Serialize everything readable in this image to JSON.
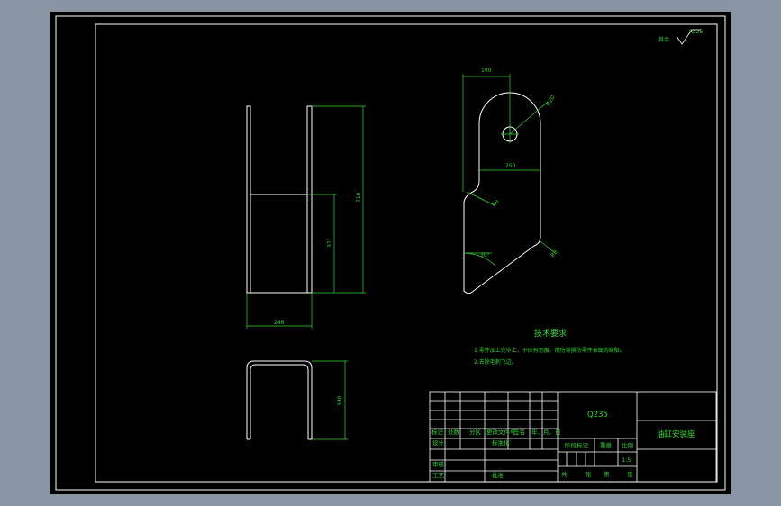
{
  "roughness": {
    "label": "其余",
    "value": "Ra25"
  },
  "dimensions": {
    "top_width": "100",
    "hole": "Φ20",
    "mid_width": "250",
    "fillet_left": "R8",
    "fillet_right": "R8",
    "angle": "30°",
    "side_height": "710",
    "inner_height": "371",
    "side_width": "246",
    "bottom_height": "330"
  },
  "tech_requirements": {
    "title": "技术要求",
    "items": [
      "1.零件加工完毕上，不应有划痕、擦伤等损伤零件表面的缺陷。",
      "2.去除毛刺飞边。"
    ]
  },
  "title_block": {
    "material": "Q235",
    "part_name": "油缸安装座",
    "scale": "1:5",
    "header_row": [
      "标记",
      "处数",
      "分区",
      "更改文件号",
      "签名",
      "年、月、日"
    ],
    "design": "设计",
    "standardize": "标准化",
    "review": "审核",
    "process": "工艺",
    "approve": "批准",
    "stage_mark": "阶段标记",
    "weight": "重量",
    "ratio": "比例",
    "sheets_total": "共",
    "sheets_unit": "张",
    "sheet_no": "第",
    "sheet_unit": "张"
  }
}
